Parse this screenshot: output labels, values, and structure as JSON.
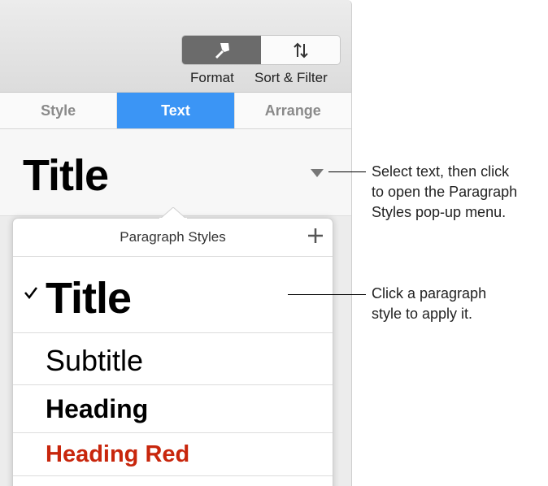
{
  "toolbar": {
    "format_label": "Format",
    "sort_filter_label": "Sort & Filter",
    "format_icon": "paintbrush-icon",
    "sort_icon": "sort-arrows-icon"
  },
  "tabs": [
    {
      "label": "Style"
    },
    {
      "label": "Text"
    },
    {
      "label": "Arrange"
    }
  ],
  "current_style": "Title",
  "popover": {
    "title": "Paragraph Styles",
    "items": [
      {
        "label": "Title",
        "checked": true
      },
      {
        "label": "Subtitle"
      },
      {
        "label": "Heading"
      },
      {
        "label": "Heading Red"
      }
    ]
  },
  "callouts": {
    "first": [
      "Select text, then click",
      "to open the Paragraph",
      "Styles pop-up menu."
    ],
    "second": [
      "Click a paragraph",
      "style to apply it."
    ]
  },
  "colors": {
    "accent": "#3b95f5",
    "heading_red": "#c8260c"
  }
}
